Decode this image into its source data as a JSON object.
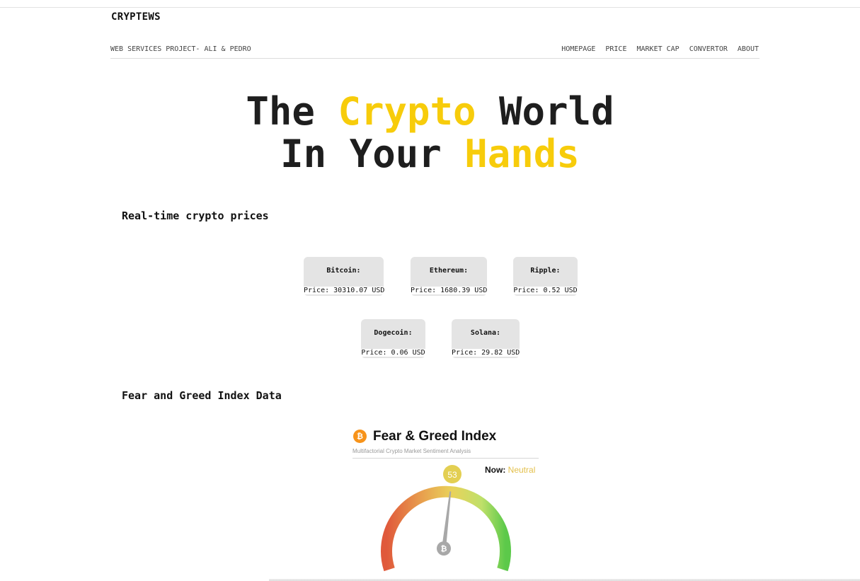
{
  "header": {
    "brand": "CRYPTEWS",
    "subtitle": "WEB SERVICES PROJECT- ALI & PEDRO",
    "nav": [
      "HOMEPAGE",
      "PRICE",
      "MARKET CAP",
      "CONVERTOR",
      "ABOUT"
    ]
  },
  "hero": {
    "line1_a": "The ",
    "line1_b": "Crypto",
    "line1_c": " World",
    "line2_a": "In Your ",
    "line2_b": "Hands"
  },
  "prices": {
    "title": "Real-time crypto prices",
    "cards": [
      {
        "name": "Bitcoin:",
        "price": "Price: 30310.07 USD"
      },
      {
        "name": "Ethereum:",
        "price": "Price: 1680.39 USD"
      },
      {
        "name": "Ripple:",
        "price": "Price: 0.52 USD"
      },
      {
        "name": "Dogecoin:",
        "price": "Price: 0.06 USD"
      },
      {
        "name": "Solana:",
        "price": "Price: 29.82 USD"
      }
    ]
  },
  "fear_greed": {
    "section_title": "Fear and Greed Index Data",
    "widget_title": "Fear & Greed Index",
    "widget_subtitle": "Multifactorial Crypto Market Sentiment Analysis",
    "now_label": "Now:",
    "now_status": "Neutral",
    "value": "53",
    "value_numeric": 53,
    "logo_glyph": "₿"
  },
  "colors": {
    "accent": "#f7cc0b",
    "neutral": "#e3c04c",
    "btc_orange": "#f7931a"
  }
}
